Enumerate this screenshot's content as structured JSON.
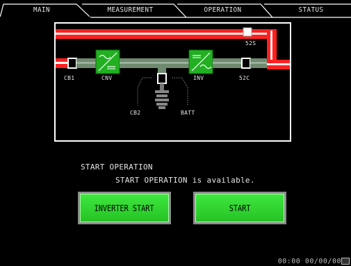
{
  "tabs": [
    {
      "label": "MAIN",
      "active": true
    },
    {
      "label": "MEASUREMENT",
      "active": false
    },
    {
      "label": "OPERATION",
      "active": false
    },
    {
      "label": "STATUS",
      "active": false
    }
  ],
  "diagram": {
    "labels": {
      "cb1": "CB1",
      "cnv": "CNV",
      "inv": "INV",
      "s52s": "52S",
      "s52c": "52C",
      "cb2": "CB2",
      "batt": "BATT"
    },
    "colors": {
      "power_line": "#ff2020",
      "power_line_highlight": "#ffffff",
      "converter": "#22b022",
      "idle_line": "#7a8a7a",
      "dotted": "#bbbbbb"
    }
  },
  "operation": {
    "title": "START OPERATION",
    "message": "START OPERATION is available."
  },
  "buttons": {
    "inverter_start": "INVERTER START",
    "start": "START"
  },
  "status_bar": {
    "clock": "00:00 00/00/00"
  }
}
